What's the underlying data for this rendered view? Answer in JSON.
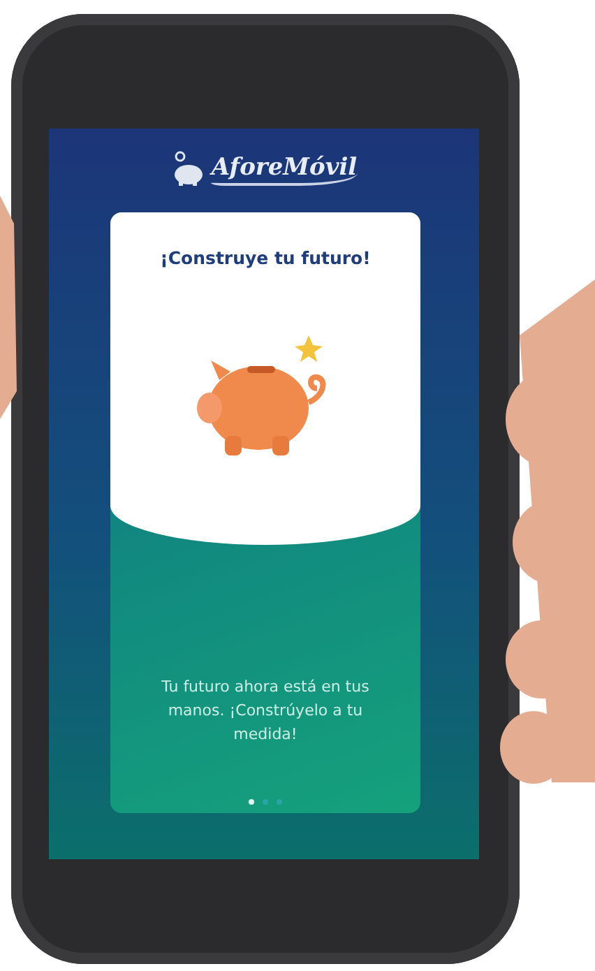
{
  "app": {
    "logo_text": "AforeMóvil"
  },
  "card": {
    "title": "¡Construye tu futuro!",
    "message": "Tu futuro ahora está en tus manos. ¡Constrúyelo a tu medida!"
  },
  "pager": [
    {
      "selected": true
    },
    {
      "selected": false
    },
    {
      "selected": false
    }
  ]
}
